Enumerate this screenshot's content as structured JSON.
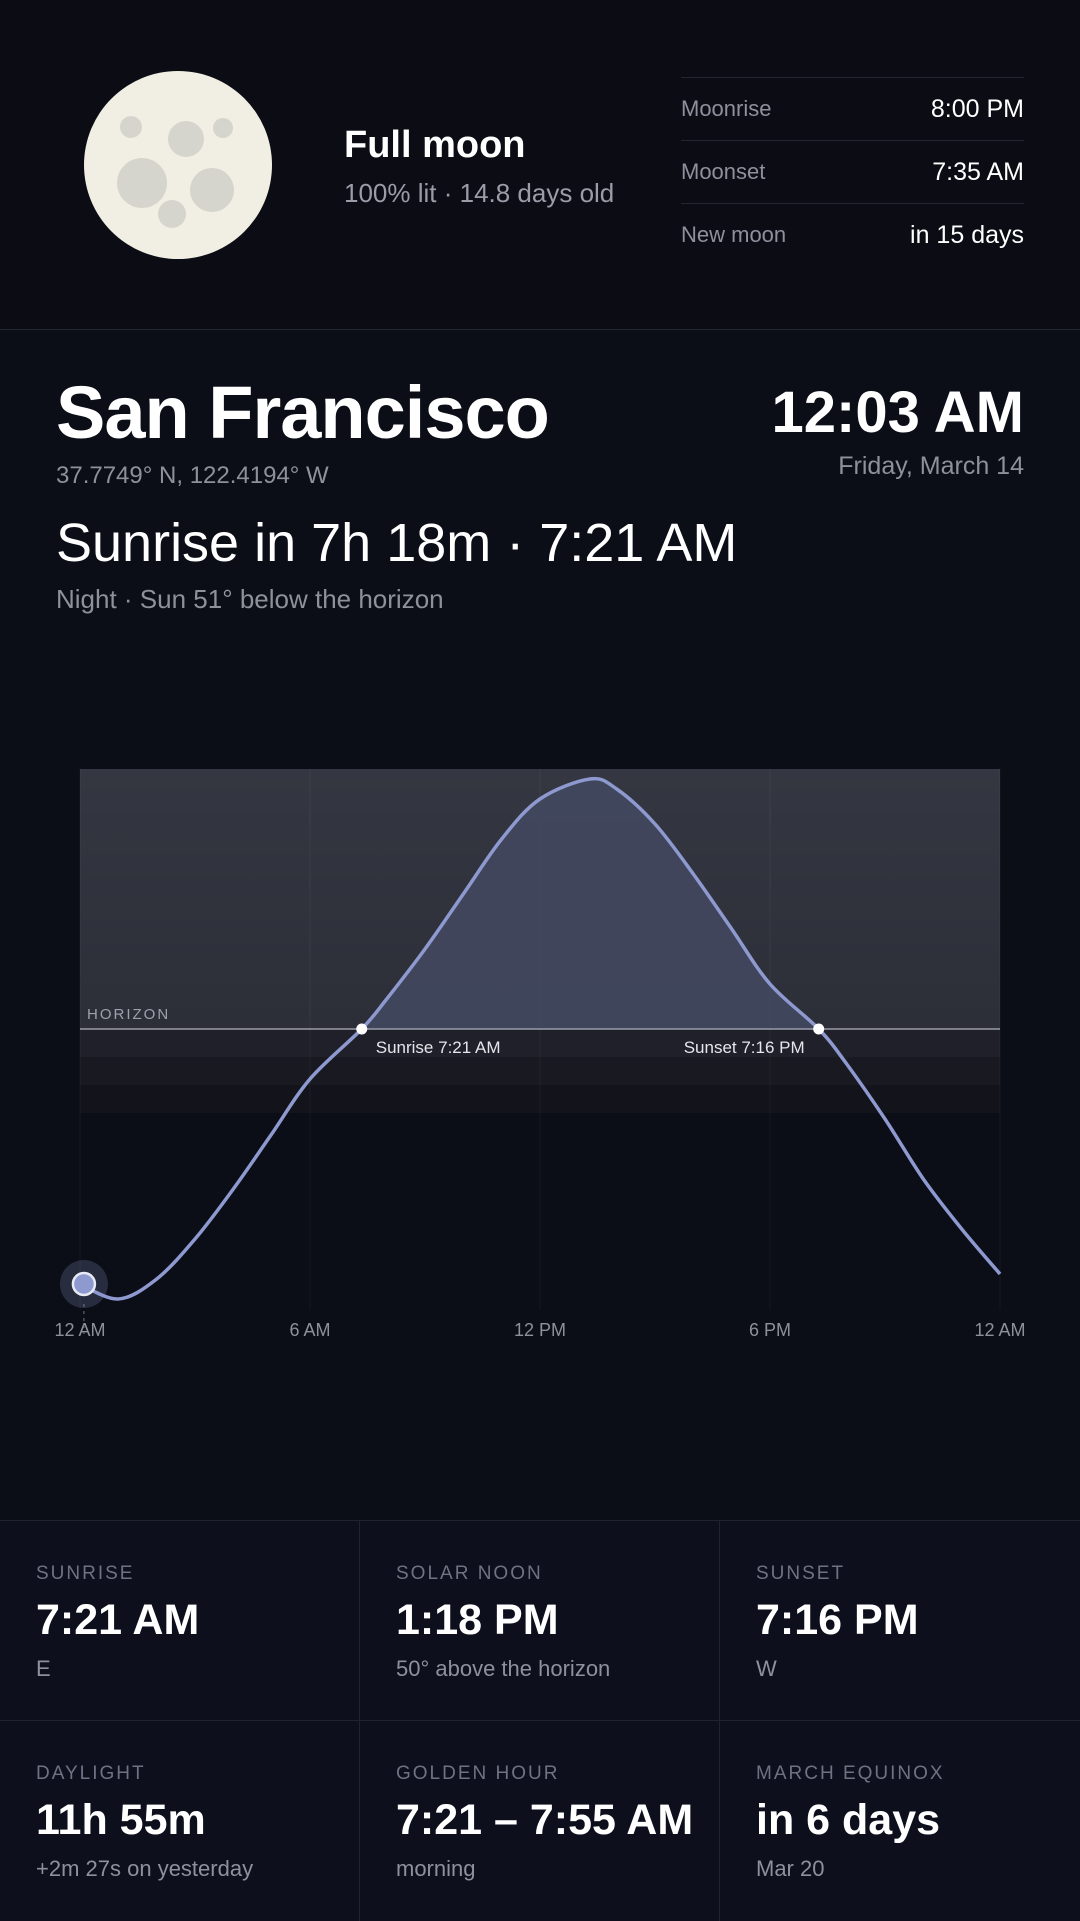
{
  "moon": {
    "phase": "Full moon",
    "details": "100% lit · 14.8 days old",
    "rows": [
      {
        "label": "Moonrise",
        "value": "8:00 PM"
      },
      {
        "label": "Moonset",
        "value": "7:35 AM"
      },
      {
        "label": "New moon",
        "value": "in 15 days"
      }
    ]
  },
  "location": {
    "name": "San Francisco",
    "coords": "37.7749° N, 122.4194° W",
    "time": "12:03 AM",
    "date": "Friday, March 14"
  },
  "headline": {
    "countdown": "Sunrise in 7h 18m · 7:21 AM",
    "status": "Night · Sun 51° below the horizon"
  },
  "chart_data": {
    "type": "line",
    "title": "",
    "xlabel": "",
    "ylabel": "",
    "x_ticks": [
      "12 AM",
      "6 AM",
      "12 PM",
      "6 PM",
      "12 AM"
    ],
    "horizon_label": "HORIZON",
    "series": [
      {
        "x_hours": [
          0,
          1,
          2,
          3,
          4,
          5,
          6,
          7.35,
          8,
          9,
          10,
          11,
          12,
          13.3,
          14,
          15,
          16,
          17,
          18,
          19.27,
          20,
          21,
          22,
          23,
          24
        ],
        "elevation_deg": [
          -51,
          -54,
          -50,
          -42,
          -32,
          -21,
          -10,
          0,
          6,
          16,
          27,
          38,
          46,
          50,
          48,
          41,
          31,
          20,
          9,
          0,
          -7,
          -18,
          -30,
          -40,
          -49
        ]
      }
    ],
    "current_hour": 0.05,
    "events": [
      {
        "label": "Sunrise 7:21 AM",
        "hour": 7.35
      },
      {
        "label": "Sunset 7:16 PM",
        "hour": 19.27
      }
    ],
    "colors": {
      "curve": "#8d99cf",
      "day_fill": "#434961",
      "marker": "#8d99cf"
    }
  },
  "stats": [
    {
      "label": "SUNRISE",
      "value": "7:21 AM",
      "sub": "E"
    },
    {
      "label": "SOLAR NOON",
      "value": "1:18 PM",
      "sub": "50° above the horizon"
    },
    {
      "label": "SUNSET",
      "value": "7:16 PM",
      "sub": "W"
    },
    {
      "label": "DAYLIGHT",
      "value": "11h 55m",
      "sub": "+2m 27s on yesterday"
    },
    {
      "label": "GOLDEN HOUR",
      "value": "7:21 – 7:55 AM",
      "sub": "morning"
    },
    {
      "label": "MARCH EQUINOX",
      "value": "in 6 days",
      "sub": "Mar 20"
    }
  ]
}
